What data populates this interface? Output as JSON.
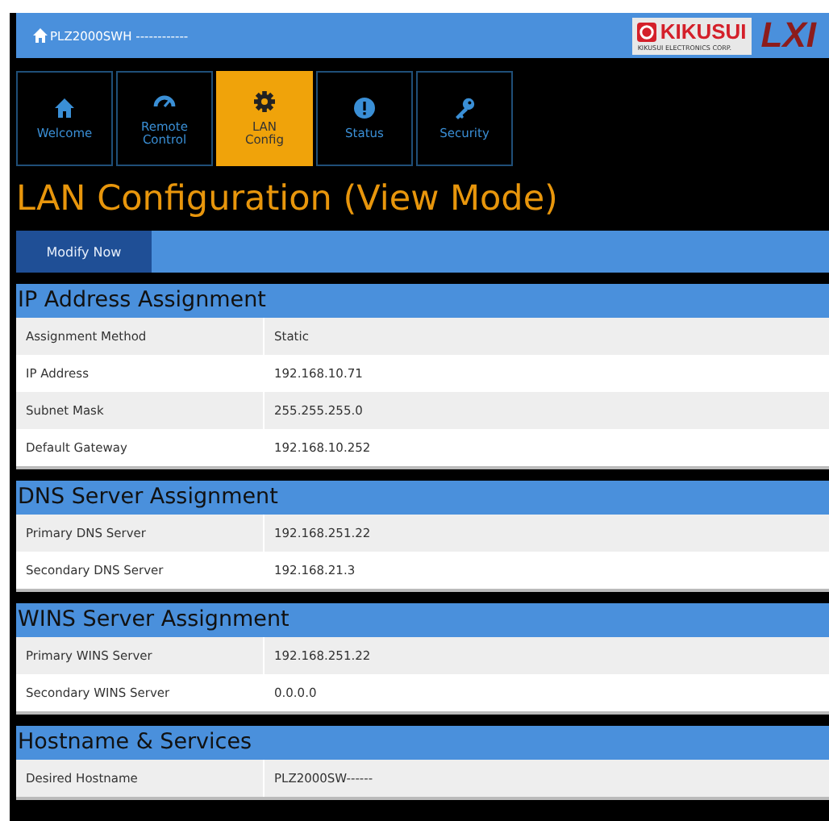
{
  "header": {
    "title": "PLZ2000SWH ------------",
    "logo": {
      "brand": "KIKUSUI",
      "subtitle": "KIKUSUI ELECTRONICS CORP.",
      "badge": "LXI"
    }
  },
  "tabs": [
    {
      "kind": "home",
      "label": "Welcome",
      "selected": false
    },
    {
      "kind": "gauge",
      "label": "Remote Control",
      "selected": false
    },
    {
      "kind": "gear",
      "label": "LAN Config",
      "selected": true
    },
    {
      "kind": "info",
      "label": "Status",
      "selected": false
    },
    {
      "kind": "key",
      "label": "Security",
      "selected": false
    }
  ],
  "page_title": "LAN Configuration (View Mode)",
  "toolbar": {
    "button": "Modify Now"
  },
  "sections": [
    {
      "title": "IP Address Assignment",
      "rows": [
        {
          "label": "Assignment Method",
          "value": "Static"
        },
        {
          "label": "IP Address",
          "value": "192.168.10.71"
        },
        {
          "label": "Subnet Mask",
          "value": "255.255.255.0"
        },
        {
          "label": "Default Gateway",
          "value": "192.168.10.252"
        }
      ]
    },
    {
      "title": "DNS Server Assignment",
      "rows": [
        {
          "label": "Primary DNS Server",
          "value": "192.168.251.22"
        },
        {
          "label": "Secondary DNS Server",
          "value": "192.168.21.3"
        }
      ]
    },
    {
      "title": "WINS Server Assignment",
      "rows": [
        {
          "label": "Primary WINS Server",
          "value": "192.168.251.22"
        },
        {
          "label": "Secondary WINS Server",
          "value": "0.0.0.0"
        }
      ]
    },
    {
      "title": "Hostname & Services",
      "rows": [
        {
          "label": "Desired Hostname",
          "value": "PLZ2000SW------"
        }
      ]
    }
  ]
}
